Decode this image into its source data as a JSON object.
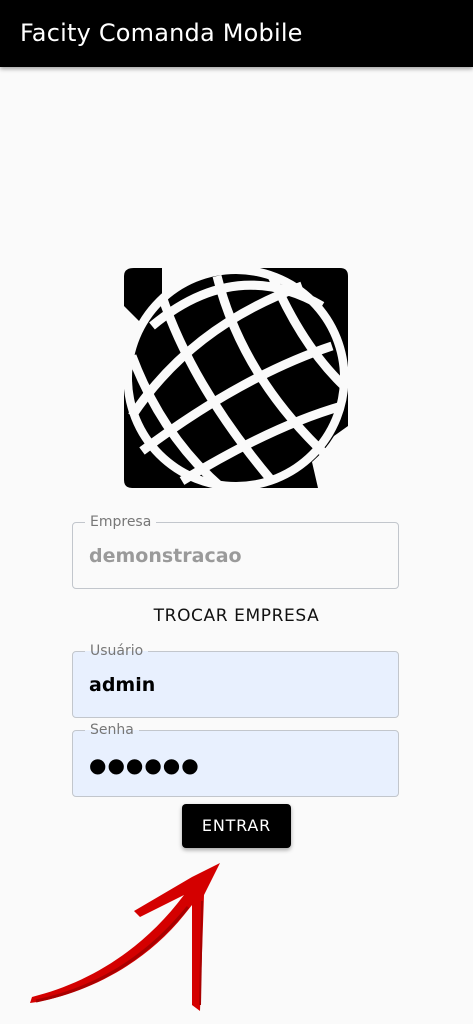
{
  "appbar": {
    "title": "Facity Comanda Mobile",
    "background": "#000000"
  },
  "logo": {
    "icon": "globe-logo-icon"
  },
  "empresa": {
    "label": "Empresa",
    "value": "demonstracao"
  },
  "trocar_empresa": {
    "label": "TROCAR EMPRESA"
  },
  "usuario": {
    "label": "Usuário",
    "value": "admin"
  },
  "senha": {
    "label": "Senha",
    "value": "●●●●●●"
  },
  "entrar_button": {
    "label": "ENTRAR"
  },
  "annotation": {
    "icon": "red-arrow-icon",
    "color": "#d40000"
  },
  "colors": {
    "autofill_bg": "#e8f0fe",
    "page_bg": "#fafafa",
    "primary": "#000000"
  }
}
